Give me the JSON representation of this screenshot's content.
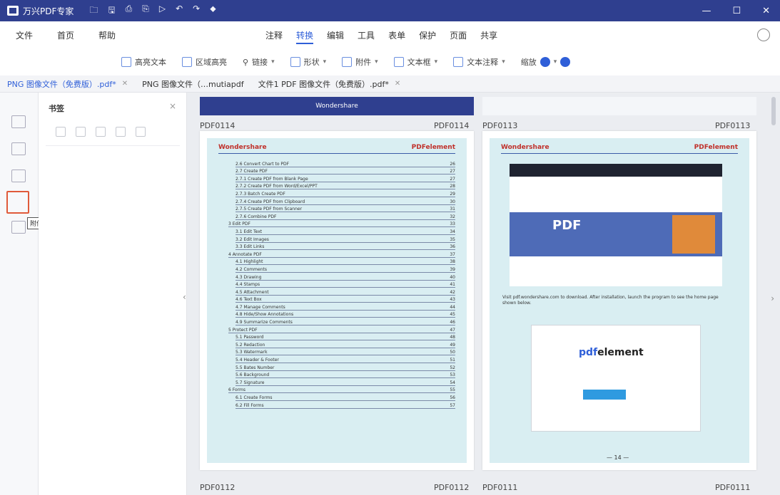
{
  "titlebar": {
    "app_name": "万兴PDF专家",
    "quick_actions": [
      "🗀",
      "🖫",
      "⎙",
      "⎘",
      "▷",
      "↶",
      "↷",
      "⬥"
    ],
    "window_controls": [
      "—",
      "☐",
      "✕"
    ]
  },
  "menubar": {
    "left": [
      "文件",
      "首页",
      "帮助"
    ],
    "center": [
      "注释",
      "转换",
      "编辑",
      "工具",
      "表单",
      "保护",
      "页面",
      "共享"
    ],
    "active": "转换"
  },
  "toolbar": {
    "items": [
      "高亮文本",
      "区域高亮",
      "链接",
      "形状",
      "附件",
      "文本框",
      "文本注释",
      "缩放"
    ]
  },
  "tabs": [
    {
      "label": "PNG 图像文件（免费版）.pdf*",
      "active": true
    },
    {
      "label": "PNG 图像文件（…mutiapdf",
      "active": false
    },
    {
      "label": "文件1 PDF 图像文件（免费版）.pdf*",
      "active": false
    }
  ],
  "left_panel": {
    "title": "书签",
    "close": "×",
    "tooltip": "附件"
  },
  "document": {
    "top_strip_brand": "Wondershare",
    "page_labels": {
      "p1_left": "PDF0114",
      "p1_right": "PDF0114",
      "p2_left": "PDF0113",
      "p2_right": "PDF0113",
      "p3_left": "PDF0112",
      "p3_right": "PDF0112",
      "p4_left": "PDF0111",
      "p4_right": "PDF0111"
    },
    "toc_brand_left": "Wondershare",
    "toc_brand_right": "PDFelement",
    "toc_rows": [
      "2.6 Convert Chart to PDF",
      "2.7 Create PDF",
      "2.7.1 Create PDF from Blank Page",
      "2.7.2 Create PDF from Word/Excel/PPT",
      "2.7.3 Batch Create PDF",
      "2.7.4 Create PDF from Clipboard",
      "2.7.5 Create PDF from Scanner",
      "2.7.6 Combine PDF",
      "3 Edit PDF",
      "3.1 Edit Text",
      "3.2 Edit Images",
      "3.3 Edit Links",
      "4 Annotate PDF",
      "4.1 Highlight",
      "4.2 Comments",
      "4.3 Drawing",
      "4.4 Stamps",
      "4.5 Attachment",
      "4.6 Text Box",
      "4.7 Manage Comments",
      "4.8 Hide/Show Annotations",
      "4.9 Summarize Comments",
      "5 Protect PDF",
      "5.1 Password",
      "5.2 Redaction",
      "5.3 Watermark",
      "5.4 Header & Footer",
      "5.5 Bates Number",
      "5.6 Background",
      "5.7 Signature",
      "6 Forms",
      "6.1 Create Forms",
      "6.2 Fill Forms"
    ],
    "toc_page_nums": [
      "26",
      "27",
      "27",
      "28",
      "29",
      "30",
      "31",
      "32",
      "33",
      "34",
      "35",
      "36",
      "37",
      "38",
      "39",
      "40",
      "41",
      "42",
      "43",
      "44",
      "45",
      "46",
      "47",
      "48",
      "49",
      "50",
      "51",
      "52",
      "53",
      "54",
      "55",
      "56",
      "57"
    ],
    "right_brand_left": "Wondershare",
    "right_brand_right": "PDFelement",
    "hero_text": "PDF",
    "para_text": "Visit pdf.wondershare.com to download. After installation, launch the program to see the home page shown below.",
    "pdf_logo_pre": "pdf",
    "pdf_logo_post": "element",
    "page_num": "— 14 —"
  }
}
